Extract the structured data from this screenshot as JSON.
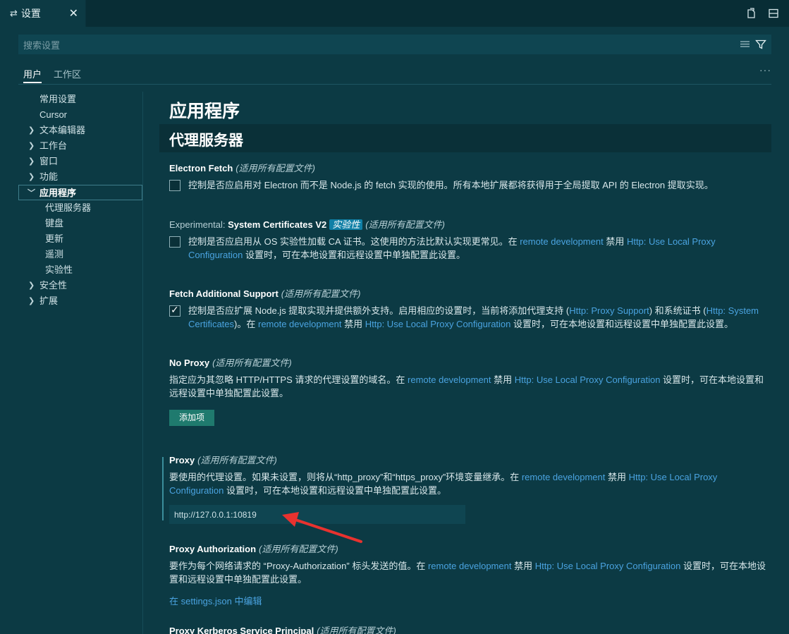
{
  "tab": {
    "icon": "settings-sliders-icon",
    "title": "设置",
    "close": "✕"
  },
  "actions": {
    "open_json": "open-settings-json-icon",
    "split": "split-editor-icon"
  },
  "search": {
    "placeholder": "搜索设置",
    "clear_filter": "clear-filter-icon",
    "filter": "filter-icon"
  },
  "scope_tabs": [
    {
      "label": "用户",
      "active": true
    },
    {
      "label": "工作区",
      "active": false
    }
  ],
  "scope_more": "···",
  "toc": [
    {
      "label": "常用设置",
      "level": 0,
      "expandable": false
    },
    {
      "label": "Cursor",
      "level": 0,
      "expandable": false
    },
    {
      "label": "文本编辑器",
      "level": 0,
      "expandable": true,
      "expanded": false
    },
    {
      "label": "工作台",
      "level": 0,
      "expandable": true,
      "expanded": false
    },
    {
      "label": "窗口",
      "level": 0,
      "expandable": true,
      "expanded": false
    },
    {
      "label": "功能",
      "level": 0,
      "expandable": true,
      "expanded": false
    },
    {
      "label": "应用程序",
      "level": 0,
      "expandable": true,
      "expanded": true,
      "selected": true
    },
    {
      "label": "代理服务器",
      "level": 1
    },
    {
      "label": "键盘",
      "level": 1
    },
    {
      "label": "更新",
      "level": 1
    },
    {
      "label": "遥测",
      "level": 1
    },
    {
      "label": "实验性",
      "level": 1
    },
    {
      "label": "安全性",
      "level": 0,
      "expandable": true,
      "expanded": false
    },
    {
      "label": "扩展",
      "level": 0,
      "expandable": true,
      "expanded": false
    }
  ],
  "section": {
    "h1": "应用程序",
    "h2": "代理服务器"
  },
  "scope_note": "(适用所有配置文件)",
  "link_remote": "remote development",
  "link_local_proxy": "Http: Use Local Proxy Configuration",
  "link_local_proxy_a": "Http: Use Local Proxy",
  "link_local_proxy_b": "Configuration",
  "settings": {
    "electron_fetch": {
      "title": "Electron Fetch",
      "checked": false,
      "desc": "控制是否应启用对 Electron 而不是 Node.js 的 fetch 实现的使用。所有本地扩展都将获得用于全局提取 API 的 Electron 提取实现。"
    },
    "system_certs": {
      "prefix": "Experimental: ",
      "title": "System Certificates V2",
      "badge": "实验性",
      "checked": false,
      "desc_a": "控制是否应启用从 OS 实验性加载 CA 证书。这使用的方法比默认实现更常见。在 ",
      "desc_b": " 禁用 ",
      "desc_c": " 设置时，可在本地设置和远程设置中单独配置此设置。"
    },
    "fetch_support": {
      "title": "Fetch Additional Support",
      "checked": true,
      "desc_a": "控制是否应扩展 Node.js 提取实现并提供额外支持。启用相应的设置时，当前将添加代理支持 (",
      "link_proxy_support": "Http: Proxy Support",
      "desc_b": ") 和系统证书 (",
      "link_system_certs": "Http: System Certificates",
      "desc_c": ")。在 ",
      "desc_d": " 禁用 ",
      "desc_e": " 设置时，可在本地设置和远程设置中单独配置此设置。"
    },
    "no_proxy": {
      "title": "No Proxy",
      "desc_a": "指定应为其忽略 HTTP/HTTPS 请求的代理设置的域名。在 ",
      "desc_b": " 禁用 ",
      "desc_c": " 设置时，可在本地设置和远程设置中单独配置此设置。",
      "add_button": "添加项"
    },
    "proxy": {
      "title": "Proxy",
      "desc_a": "要使用的代理设置。如果未设置，则将从“http_proxy”和“https_proxy”环境变量继承。在 ",
      "desc_b": " 禁用 ",
      "desc_c": " 设置时，可在本地设置和远程设置中单独配置此设置。",
      "value": "http://127.0.0.1:10819"
    },
    "proxy_auth": {
      "title": "Proxy Authorization",
      "desc_a": "要作为每个网络请求的 “Proxy-Authorization” 标头发送的值。在 ",
      "desc_b": " 禁用 ",
      "desc_c": " 设置时，可在本地设置和远程设置中单独配置此设置。",
      "edit_link": "在 settings.json 中编辑"
    },
    "kerberos": {
      "title": "Proxy Kerberos Service Principal"
    }
  },
  "annotation": {
    "arrow_color": "#e8322f"
  }
}
